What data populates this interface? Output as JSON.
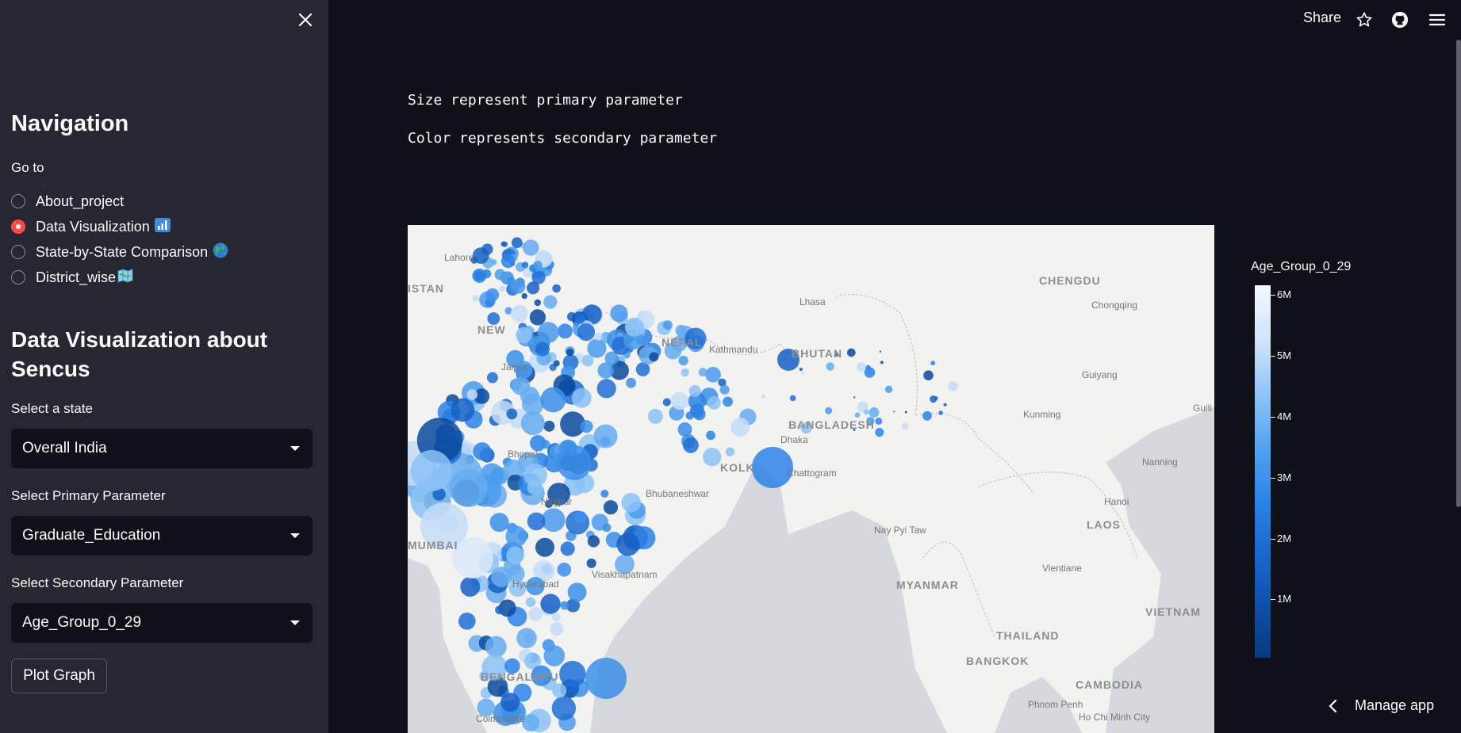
{
  "sidebar": {
    "nav_title": "Navigation",
    "goto_label": "Go to",
    "nav_options": [
      {
        "label": "About_project",
        "emoji": "",
        "selected": false
      },
      {
        "label": "Data Visualization",
        "emoji": "bar-chart",
        "selected": true
      },
      {
        "label": "State-by-State Comparison",
        "emoji": "globe",
        "selected": false
      },
      {
        "label": "District_wise",
        "emoji": "map",
        "selected": false
      }
    ],
    "viz_title": "Data Visualization about Sencus",
    "state_label": "Select a state",
    "state_value": "Overall India",
    "primary_label": "Select Primary Parameter",
    "primary_value": "Graduate_Education",
    "secondary_label": "Select Secondary Parameter",
    "secondary_value": "Age_Group_0_29",
    "plot_button": "Plot Graph"
  },
  "header": {
    "share": "Share",
    "icons": [
      "star-icon",
      "github-icon",
      "menu-icon"
    ]
  },
  "main": {
    "line1": "Size represent primary parameter",
    "line2": "Color represents secondary parameter"
  },
  "map": {
    "labels": [
      {
        "text": "Lahore",
        "kind": "city"
      },
      {
        "text": "ISTAN",
        "kind": "country"
      },
      {
        "text": "NEW",
        "kind": "country"
      },
      {
        "text": "Jaipur",
        "kind": "city"
      },
      {
        "text": "NEPAL",
        "kind": "country"
      },
      {
        "text": "Kathmandu",
        "kind": "city"
      },
      {
        "text": "Lhasa",
        "kind": "city"
      },
      {
        "text": "CHENGDU",
        "kind": "city"
      },
      {
        "text": "Chongqing",
        "kind": "city"
      },
      {
        "text": "BHUTAN",
        "kind": "country"
      },
      {
        "text": "Guiyang",
        "kind": "city"
      },
      {
        "text": "BANGLADESH",
        "kind": "country"
      },
      {
        "text": "Dhaka",
        "kind": "city"
      },
      {
        "text": "Kunming",
        "kind": "city"
      },
      {
        "text": "Guili",
        "kind": "city"
      },
      {
        "text": "KOLK",
        "kind": "country"
      },
      {
        "text": "Chattogram",
        "kind": "city"
      },
      {
        "text": "Nanning",
        "kind": "city"
      },
      {
        "text": "Bhopal",
        "kind": "city"
      },
      {
        "text": "Nagpur",
        "kind": "city"
      },
      {
        "text": "Bhubaneshwar",
        "kind": "city"
      },
      {
        "text": "Hanoi",
        "kind": "city"
      },
      {
        "text": "MUMBAI",
        "kind": "country"
      },
      {
        "text": "Nay Pyi Taw",
        "kind": "city"
      },
      {
        "text": "LAOS",
        "kind": "country"
      },
      {
        "text": "Vientiane",
        "kind": "city"
      },
      {
        "text": "Hyderabad",
        "kind": "city"
      },
      {
        "text": "Visakhapatnam",
        "kind": "city"
      },
      {
        "text": "MYANMAR",
        "kind": "country"
      },
      {
        "text": "VIETNAM",
        "kind": "country"
      },
      {
        "text": "THAILAND",
        "kind": "country"
      },
      {
        "text": "BANGKOK",
        "kind": "country"
      },
      {
        "text": "CAMBODIA",
        "kind": "country"
      },
      {
        "text": "BENGALURU",
        "kind": "country"
      },
      {
        "text": "Phnom Penh",
        "kind": "city"
      },
      {
        "text": "Ho Chi Minh City",
        "kind": "city"
      },
      {
        "text": "Coimbatore",
        "kind": "city"
      }
    ]
  },
  "colorbar": {
    "title": "Age_Group_0_29",
    "ticks": [
      "6M",
      "5M",
      "4M",
      "3M",
      "2M",
      "1M"
    ]
  },
  "footer": {
    "manage_app": "Manage app"
  }
}
